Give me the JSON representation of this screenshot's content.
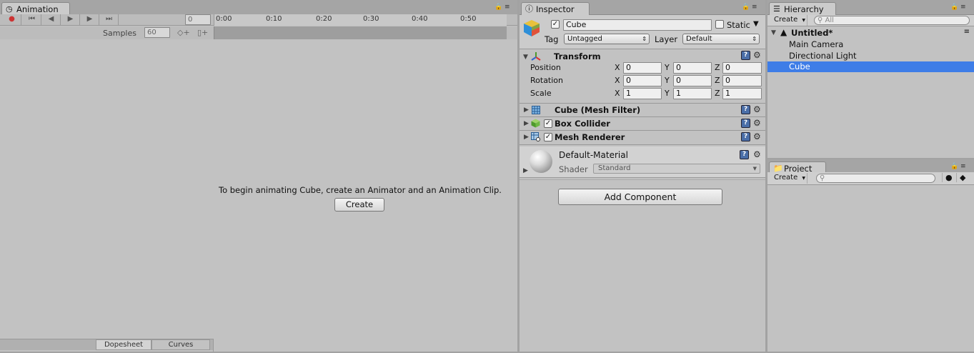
{
  "animation": {
    "tab_label": "Animation",
    "frame_value": "0",
    "timeline_ticks": [
      "0:00",
      "0:10",
      "0:20",
      "0:30",
      "0:40",
      "0:50"
    ],
    "samples_label": "Samples",
    "samples_value": "60",
    "message": "To begin animating Cube, create an Animator and an Animation Clip.",
    "create_label": "Create",
    "bottom_tabs": [
      "Dopesheet",
      "Curves"
    ]
  },
  "inspector": {
    "tab_label": "Inspector",
    "object_name": "Cube",
    "static_label": "Static",
    "tag_label": "Tag",
    "tag_value": "Untagged",
    "layer_label": "Layer",
    "layer_value": "Default",
    "transform": {
      "title": "Transform",
      "rows": [
        {
          "label": "Position",
          "x": "0",
          "y": "0",
          "z": "0"
        },
        {
          "label": "Rotation",
          "x": "0",
          "y": "0",
          "z": "0"
        },
        {
          "label": "Scale",
          "x": "1",
          "y": "1",
          "z": "1"
        }
      ],
      "axis_x": "X",
      "axis_y": "Y",
      "axis_z": "Z"
    },
    "components": [
      "Cube (Mesh Filter)",
      "Box Collider",
      "Mesh Renderer"
    ],
    "material": {
      "name": "Default-Material",
      "shader_label": "Shader",
      "shader_value": "Standard"
    },
    "add_component_label": "Add Component"
  },
  "hierarchy": {
    "tab_label": "Hierarchy",
    "create_label": "Create",
    "search_placeholder": "All",
    "scene_name": "Untitled*",
    "items": [
      "Main Camera",
      "Directional Light",
      "Cube"
    ],
    "selected_color": "#3e7de7"
  },
  "project": {
    "tab_label": "Project",
    "create_label": "Create"
  }
}
